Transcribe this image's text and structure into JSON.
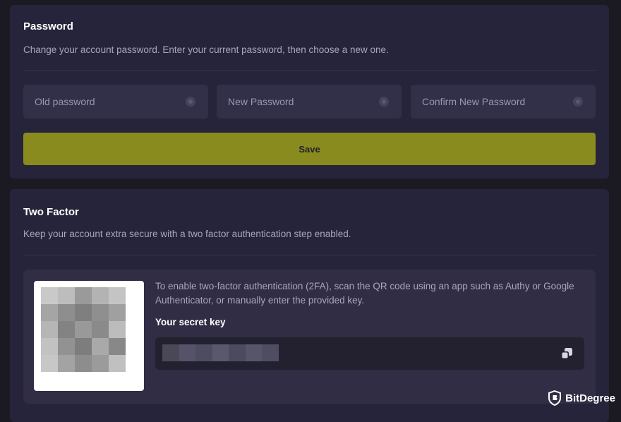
{
  "password_section": {
    "title": "Password",
    "description": "Change your account password. Enter your current password, then choose a new one.",
    "fields": [
      {
        "placeholder": "Old password",
        "value": ""
      },
      {
        "placeholder": "New Password",
        "value": ""
      },
      {
        "placeholder": "Confirm New Password",
        "value": ""
      }
    ],
    "save_label": "Save",
    "colors": {
      "save_button": "#8a8b1e",
      "card": "#26243a",
      "field": "#322f48"
    }
  },
  "two_factor_section": {
    "title": "Two Factor",
    "description": "Keep your account extra secure with a two factor authentication step enabled.",
    "instructions": "To enable two-factor authentication (2FA), scan the QR code using an app such as Authy or Google Authenticator, or manually enter the provided key.",
    "secret_key_label": "Your secret key",
    "secret_key_value_state": "blurred",
    "qr_code_state": "blurred",
    "copy_icon": "copy-icon"
  },
  "watermark": {
    "brand": "BitDegree",
    "icon": "bitdegree-shield-logo"
  }
}
